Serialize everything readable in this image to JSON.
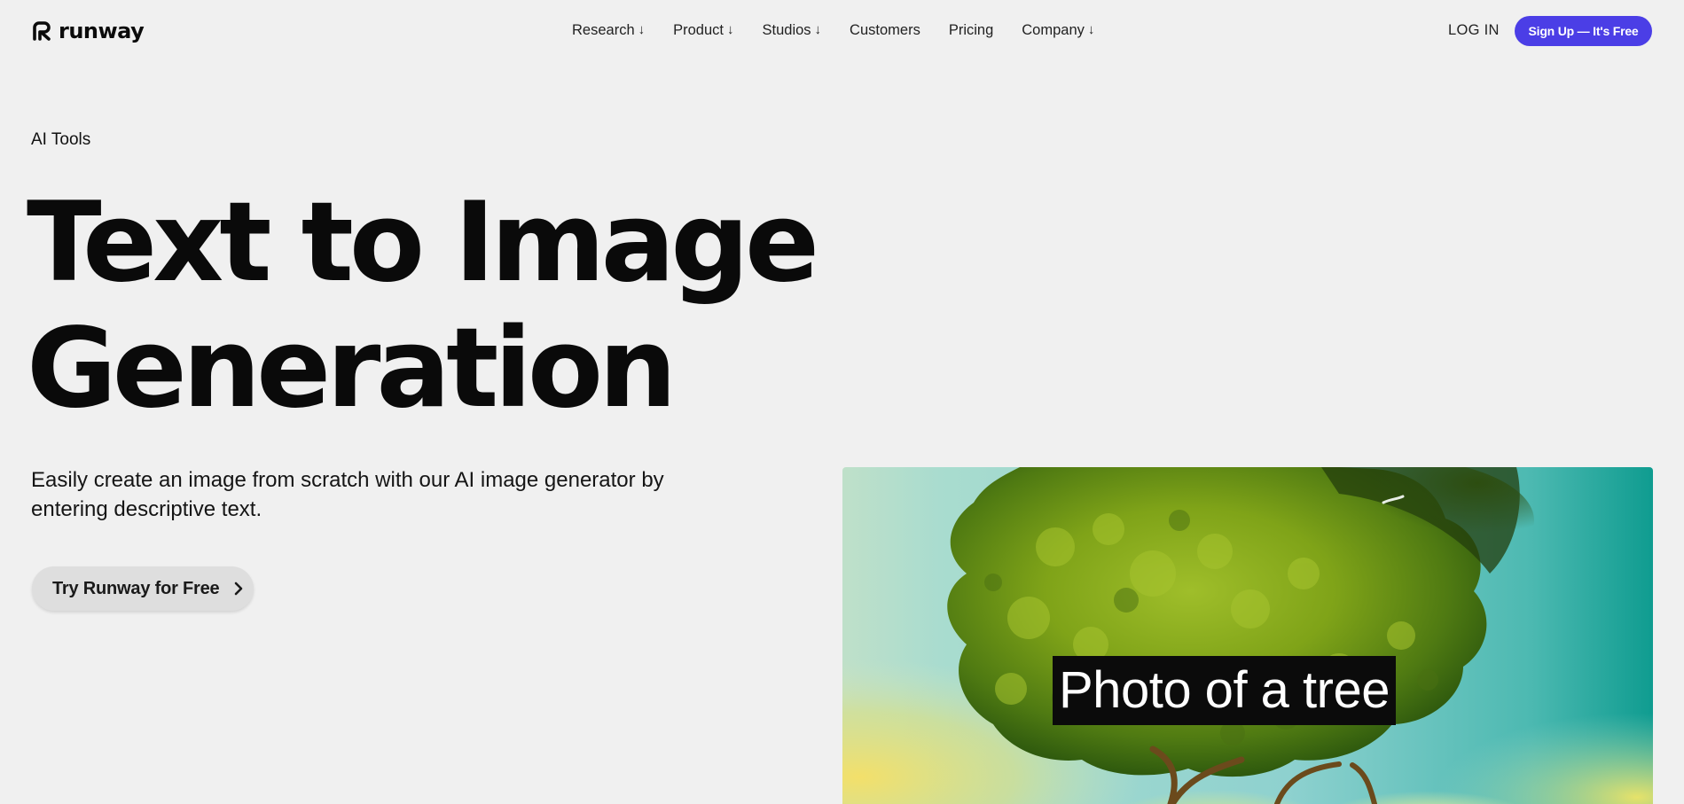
{
  "brand": {
    "name": "runway",
    "logo_icon": "runway-r-logo-icon"
  },
  "nav": {
    "items": [
      {
        "label": "Research",
        "has_dropdown": true
      },
      {
        "label": "Product",
        "has_dropdown": true
      },
      {
        "label": "Studios",
        "has_dropdown": true
      },
      {
        "label": "Customers",
        "has_dropdown": false
      },
      {
        "label": "Pricing",
        "has_dropdown": false
      },
      {
        "label": "Company",
        "has_dropdown": true
      }
    ],
    "dropdown_glyph": "↓",
    "login_label": "LOG IN",
    "signup_label": "Sign Up — It's Free"
  },
  "hero": {
    "eyebrow": "AI Tools",
    "title_line1": "Text to Image",
    "title_line2": "Generation",
    "description": "Easily create an image from scratch with our AI image generator by entering descriptive text.",
    "cta_label": "Try Runway for Free",
    "cta_icon": "chevron-right-icon"
  },
  "media": {
    "caption": "Photo of a tree",
    "image_subject": "tree-photo"
  },
  "colors": {
    "background": "#f0f0f0",
    "accent": "#4b3ee6",
    "text": "#0b0b0b",
    "cta_background": "#dedede"
  }
}
